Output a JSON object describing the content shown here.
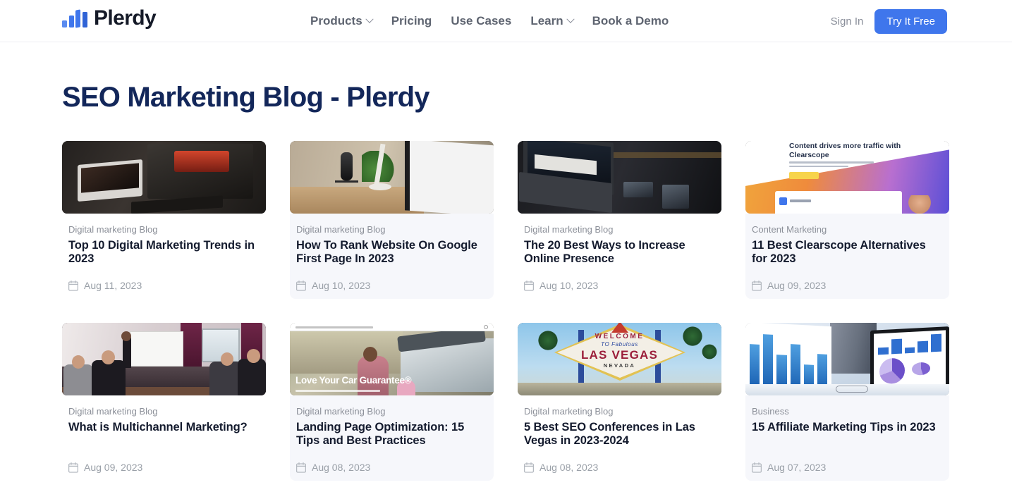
{
  "header": {
    "logo_text": "Plerdy",
    "logo_icon": "bar-chart-icon",
    "flag_icon": "ukraine-flag-icon",
    "nav": [
      {
        "label": "Products",
        "has_chevron": true
      },
      {
        "label": "Pricing",
        "has_chevron": false
      },
      {
        "label": "Use Cases",
        "has_chevron": false
      },
      {
        "label": "Learn",
        "has_chevron": true
      },
      {
        "label": "Book a Demo",
        "has_chevron": false
      }
    ],
    "sign_in": "Sign In",
    "try_free": "Try It Free",
    "accent_color": "#3f76ec"
  },
  "main": {
    "page_title": "SEO Marketing Blog - Plerdy",
    "title_color": "#13275a",
    "posts": [
      {
        "category": "Digital marketing Blog",
        "title": "Top 10 Digital Marketing Trends in 2023",
        "date": "Aug 11, 2023",
        "date_icon": "calendar-icon",
        "thumb": "dark-desk-laptop-open-neon",
        "tinted": false
      },
      {
        "category": "Digital marketing Blog",
        "title": "How To Rank Website On Google First Page In 2023",
        "date": "Aug 10, 2023",
        "date_icon": "calendar-icon",
        "thumb": "desk-microphone-imac-google",
        "tinted": true
      },
      {
        "category": "Digital marketing Blog",
        "title": "The 20 Best Ways to Increase Online Presence",
        "date": "Aug 10, 2023",
        "date_icon": "calendar-icon",
        "thumb": "dark-laptop-devices-desk",
        "tinted": false
      },
      {
        "category": "Content Marketing",
        "title": "11 Best Clearscope Alternatives for 2023",
        "date": "Aug 09, 2023",
        "date_icon": "calendar-icon",
        "thumb": "clearscope-landing-page",
        "tinted": true
      },
      {
        "category": "Digital marketing Blog",
        "title": "What is Multichannel Marketing?",
        "date": "Aug 09, 2023",
        "date_icon": "calendar-icon",
        "thumb": "business-meeting-whiteboard",
        "tinted": false
      },
      {
        "category": "Digital marketing Blog",
        "title": "Landing Page Optimization: 15 Tips and Best Practices",
        "date": "Aug 08, 2023",
        "date_icon": "calendar-icon",
        "thumb": "love-your-car-guarantee-page",
        "tinted": true
      },
      {
        "category": "Digital marketing Blog",
        "title": "5 Best SEO Conferences in Las Vegas in 2023-2024",
        "date": "Aug 08, 2023",
        "date_icon": "calendar-icon",
        "thumb": "las-vegas-welcome-sign",
        "tinted": false
      },
      {
        "category": "Business",
        "title": "15 Affiliate Marketing Tips in 2023",
        "date": "Aug 07, 2023",
        "date_icon": "calendar-icon",
        "thumb": "business-charts-handshake",
        "tinted": true
      }
    ],
    "thumb_art": {
      "clearscope_heading": "Content drives more traffic with Clearscope",
      "car_heading": "Love Your Car Guarantee®",
      "vegas_welcome": "WELCOME",
      "vegas_fabulous": "TO Fabulous",
      "vegas_city": "LAS VEGAS",
      "vegas_state": "NEVADA"
    }
  }
}
